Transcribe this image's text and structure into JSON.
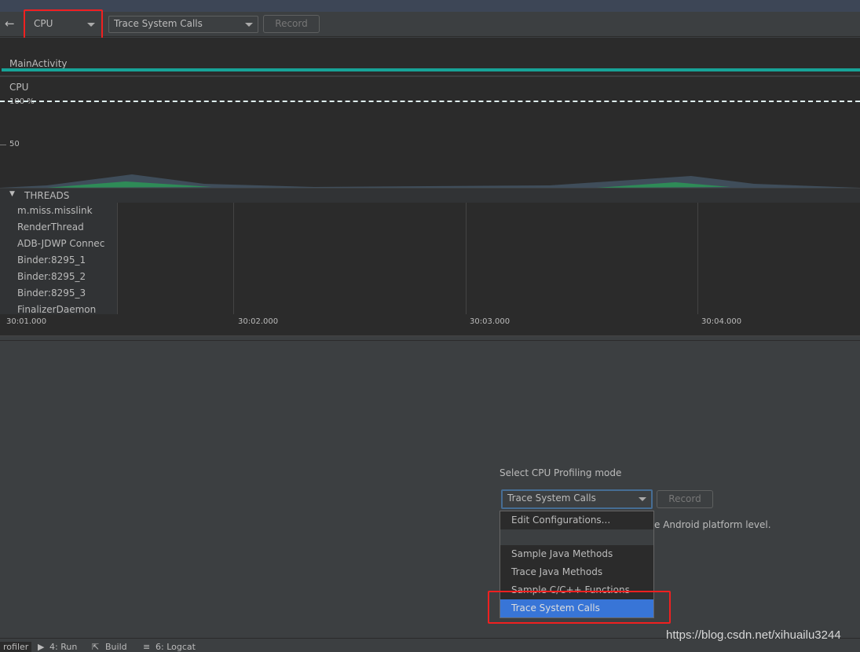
{
  "toolbar": {
    "monitor_select": "CPU",
    "mode_select": "Trace System Calls",
    "record_label": "Record"
  },
  "activity": {
    "label": "MainActivity"
  },
  "cpu_chart": {
    "title": "CPU",
    "y_ticks": [
      "100 %",
      "50"
    ],
    "colors": {
      "app": "#2e8b57",
      "other": "#3f4d5a",
      "activity_bar": "#17a398"
    }
  },
  "threads": {
    "header": "THREADS",
    "items": [
      "m.miss.misslink",
      "RenderThread",
      "ADB-JDWP Connec",
      "Binder:8295_1",
      "Binder:8295_2",
      "Binder:8295_3",
      "FinalizerDaemon"
    ]
  },
  "time_axis": [
    "30:01.000",
    "30:02.000",
    "30:03.000",
    "30:04.000"
  ],
  "profiling": {
    "title": "Select CPU Profiling mode",
    "selected": "Trace System Calls",
    "record_label": "Record",
    "description_fragment": "e Android platform level.",
    "options": [
      "Edit Configurations...",
      "",
      "Sample Java Methods",
      "Trace Java Methods",
      "Sample C/C++ Functions",
      "Trace System Calls"
    ]
  },
  "bottom_tabs": [
    "rofiler",
    "4: Run",
    "Build",
    "6: Logcat"
  ],
  "watermark": "https://blog.csdn.net/xihuailu3244"
}
